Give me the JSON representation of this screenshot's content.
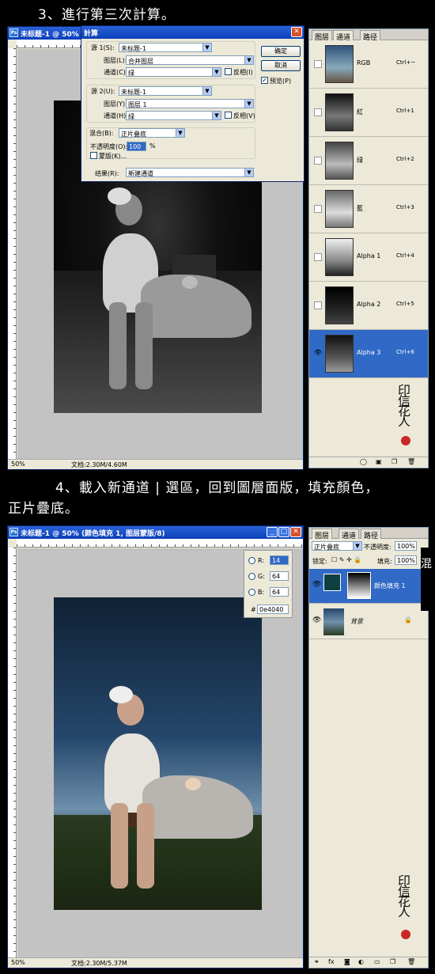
{
  "step3": {
    "caption": "3、進行第三次計算。"
  },
  "step4": {
    "caption_line1": "4、載入新通道 | 選區，回到圖層面版，填充顏色，",
    "caption_line2": "正片疊底。"
  },
  "window1": {
    "title": "未标题-1 @ 50%",
    "zoom": "50%",
    "doc_size": "文档:2.30M/4.60M"
  },
  "calc_dialog": {
    "title": "計算",
    "source1_label": "源 1(S):",
    "source1_value": "未标题-1",
    "layer1_label": "图层(L):",
    "layer1_value": "合并图层",
    "channel1_label": "通道(C):",
    "channel1_value": "绿",
    "invert1_label": "反相(I)",
    "source2_label": "源 2(U):",
    "source2_value": "未标题-1",
    "layer2_label": "图层(Y):",
    "layer2_value": "图层 1",
    "channel2_label": "通道(H):",
    "channel2_value": "绿",
    "invert2_label": "反相(V)",
    "blend_label": "混合(B):",
    "blend_value": "正片叠底",
    "opacity_label": "不透明度(O):",
    "opacity_value": "100",
    "opacity_unit": "%",
    "mask_label": "蒙版(K)...",
    "result_label": "结果(R):",
    "result_value": "新建通道",
    "ok_label": "确定",
    "cancel_label": "取消",
    "preview_label": "预览(P)",
    "preview_checked": "✓"
  },
  "channels_panel": {
    "tabs": [
      "图层",
      "通道",
      "路径"
    ],
    "channels": [
      {
        "name": "RGB",
        "shortcut": "Ctrl+~",
        "eye": ""
      },
      {
        "name": "紅",
        "shortcut": "Ctrl+1",
        "eye": ""
      },
      {
        "name": "绿",
        "shortcut": "Ctrl+2",
        "eye": ""
      },
      {
        "name": "藍",
        "shortcut": "Ctrl+3",
        "eye": ""
      },
      {
        "name": "Alpha 1",
        "shortcut": "Ctrl+4",
        "eye": ""
      },
      {
        "name": "Alpha 2",
        "shortcut": "Ctrl+5",
        "eye": ""
      },
      {
        "name": "Alpha 3",
        "shortcut": "Ctrl+6",
        "eye": "👁"
      }
    ]
  },
  "window2": {
    "title": "未标题-1 @ 50% (颜色填充 1, 图层蒙版/8)",
    "zoom": "50%",
    "doc_size": "文档:2.30M/5.37M"
  },
  "color_readout": {
    "r_label": "R:",
    "r_value": "14",
    "g_label": "G:",
    "g_value": "64",
    "b_label": "B:",
    "b_value": "64",
    "hash": "#",
    "hex_value": "0e4040"
  },
  "layers_panel": {
    "tabs": [
      "图层",
      "通道",
      "路径"
    ],
    "blend_mode": "正片叠底",
    "opacity_label": "不透明度:",
    "opacity_value": "100%",
    "lock_label": "锁定:",
    "fill_label": "填充:",
    "fill_value": "100%",
    "layers": [
      {
        "name": "颜色填充 1",
        "eye": "👁"
      },
      {
        "name": "背景",
        "eye": "👁"
      }
    ],
    "fill_swatch_color": "#0e4040",
    "side_tag": "混"
  },
  "colors": {
    "selection_blue": "#3169c6",
    "title_blue": "#0a3fb8",
    "fill_color": "#0e4040"
  },
  "signature": "印信花人"
}
